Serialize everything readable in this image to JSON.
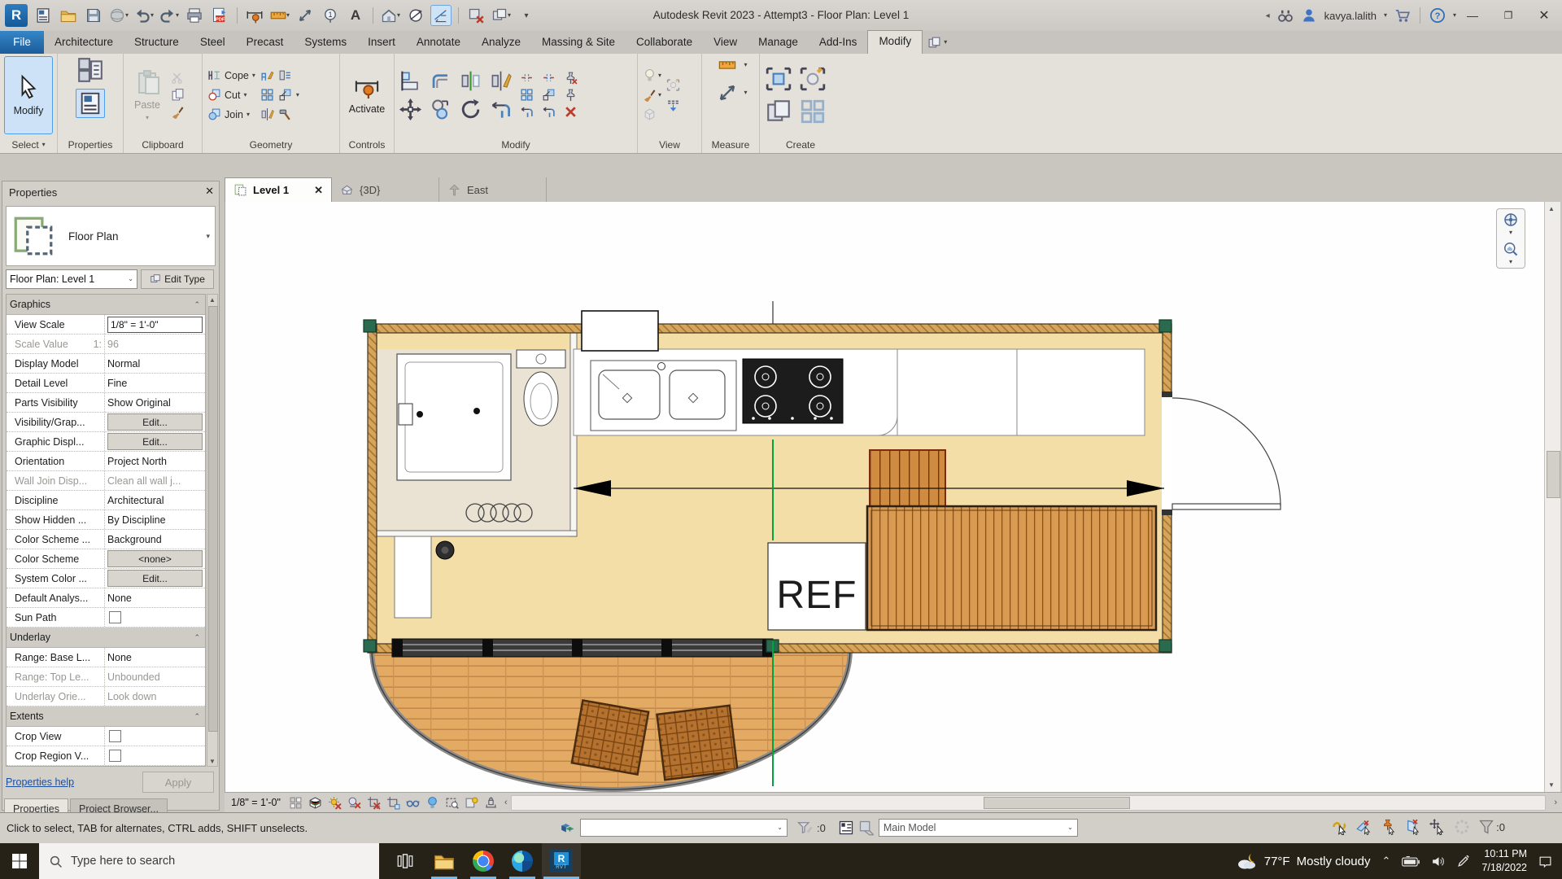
{
  "titlebar": {
    "title": "Autodesk Revit 2023 - Attempt3 - Floor Plan: Level 1",
    "user": "kavya.lalith"
  },
  "tabs": [
    {
      "label": "File",
      "file": true
    },
    {
      "label": "Architecture"
    },
    {
      "label": "Structure"
    },
    {
      "label": "Steel"
    },
    {
      "label": "Precast"
    },
    {
      "label": "Systems"
    },
    {
      "label": "Insert"
    },
    {
      "label": "Annotate"
    },
    {
      "label": "Analyze"
    },
    {
      "label": "Massing & Site"
    },
    {
      "label": "Collaborate"
    },
    {
      "label": "View"
    },
    {
      "label": "Manage"
    },
    {
      "label": "Add-Ins"
    },
    {
      "label": "Modify",
      "active": true
    }
  ],
  "ribbon": {
    "select_button": "Modify",
    "paste": "Paste",
    "cope": "Cope",
    "cut": "Cut",
    "join": "Join",
    "activate": "Activate",
    "panels": [
      "Select",
      "Properties",
      "Clipboard",
      "Geometry",
      "Controls",
      "Modify",
      "View",
      "Measure",
      "Create"
    ]
  },
  "palette": {
    "header": "Properties",
    "type_name": "Floor Plan",
    "type_selector": "Floor Plan: Level 1",
    "edit_type": "Edit Type",
    "rows": [
      {
        "section": "Graphics"
      },
      {
        "name": "View Scale",
        "value": "1/8\" = 1'-0\"",
        "kind": "input"
      },
      {
        "name": "Scale Value",
        "name2": "1:",
        "value": "96",
        "grey": true
      },
      {
        "name": "Display Model",
        "value": "Normal"
      },
      {
        "name": "Detail Level",
        "value": "Fine"
      },
      {
        "name": "Parts Visibility",
        "value": "Show Original"
      },
      {
        "name": "Visibility/Grap...",
        "value": "Edit...",
        "kind": "button"
      },
      {
        "name": "Graphic Displ...",
        "value": "Edit...",
        "kind": "button"
      },
      {
        "name": "Orientation",
        "value": "Project North"
      },
      {
        "name": "Wall Join Disp...",
        "value": "Clean all wall j...",
        "grey": true
      },
      {
        "name": "Discipline",
        "value": "Architectural"
      },
      {
        "name": "Show Hidden ...",
        "value": "By Discipline"
      },
      {
        "name": "Color Scheme ...",
        "value": "Background"
      },
      {
        "name": "Color Scheme",
        "value": "<none>",
        "kind": "button"
      },
      {
        "name": "System Color ...",
        "value": "Edit...",
        "kind": "button"
      },
      {
        "name": "Default Analys...",
        "value": "None"
      },
      {
        "name": "Sun Path",
        "kind": "checkbox"
      },
      {
        "section": "Underlay"
      },
      {
        "name": "Range: Base L...",
        "value": "None"
      },
      {
        "name": "Range: Top Le...",
        "value": "Unbounded",
        "grey": true
      },
      {
        "name": "Underlay Orie...",
        "value": "Look down",
        "grey": true
      },
      {
        "section": "Extents"
      },
      {
        "name": "Crop View",
        "kind": "checkbox"
      },
      {
        "name": "Crop Region V...",
        "kind": "checkbox"
      }
    ],
    "help_link": "Properties help",
    "apply": "Apply",
    "bottom_tabs": [
      "Properties",
      "Project Browser..."
    ]
  },
  "view_tabs": [
    {
      "label": "Level 1",
      "icon": "plan",
      "active": true,
      "closable": true
    },
    {
      "label": "{3D}",
      "icon": "home"
    },
    {
      "label": "East",
      "icon": "elev"
    }
  ],
  "canvas": {
    "ref_label": "REF"
  },
  "view_control_bar": {
    "scale": "1/8\" = 1'-0\""
  },
  "status_bar": {
    "hint": "Click to select, TAB for alternates, CTRL adds, SHIFT unselects.",
    "editable_count": ":0",
    "main_model": "Main Model",
    "filter_count": ":0"
  },
  "taskbar": {
    "search_placeholder": "Type here to search",
    "weather_temp": "77°F",
    "weather_desc": "Mostly cloudy",
    "time": "10:11 PM",
    "date": "7/18/2022"
  }
}
